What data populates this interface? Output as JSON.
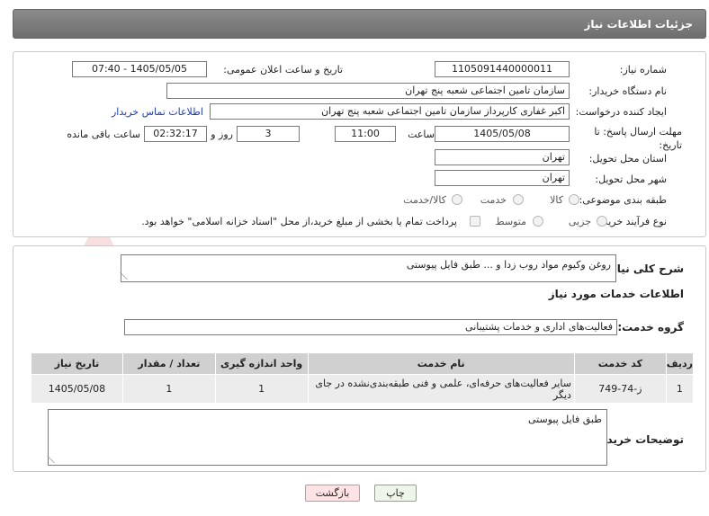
{
  "header": {
    "title": "جزئیات اطلاعات نیاز"
  },
  "form": {
    "need_number_label": "شماره نیاز:",
    "need_number": "1105091440000011",
    "announce_label": "تاریخ و ساعت اعلان عمومی:",
    "announce_value": "1405/05/05 - 07:40",
    "buyer_org_label": "نام دستگاه خریدار:",
    "buyer_org": "سازمان تامین اجتماعی شعبه پنج تهران",
    "creator_label": "ایجاد کننده درخواست:",
    "creator": "اکبر غفاری کارپرداز  سازمان تامین اجتماعی شعبه پنج تهران",
    "contact_link": "اطلاعات تماس خریدار",
    "deadline_label": "مهلت ارسال پاسخ: تا تاریخ:",
    "deadline_date": "1405/05/08",
    "time_label": "ساعت",
    "deadline_time": "11:00",
    "days_value": "3",
    "days_label": "روز و",
    "remaining_time": "02:32:17",
    "remaining_label": "ساعت باقی مانده",
    "province_label": "استان محل تحویل:",
    "province": "تهران",
    "city_label": "شهر محل تحویل:",
    "city": "تهران",
    "category_label": "طبقه بندی موضوعی:",
    "category_options": [
      "کالا",
      "خدمت",
      "کالا/خدمت"
    ],
    "purchase_type_label": "نوع فرآیند خرید :",
    "purchase_options": [
      "جزیی",
      "متوسط"
    ],
    "payment_note": "پرداخت تمام یا بخشی از مبلغ خرید،از محل \"اسناد خزانه اسلامی\" خواهد بود."
  },
  "summary": {
    "label": "شرح کلی نیاز:",
    "value": "روغن وکیوم مواد روب زدا و ... طبق فایل پیوستی"
  },
  "services_title": "اطلاعات خدمات مورد نیاز",
  "service_group": {
    "label": "گروه خدمت:",
    "value": "فعالیت‌های اداری و خدمات پشتیبانی"
  },
  "table": {
    "headers": [
      "ردیف",
      "کد خدمت",
      "نام خدمت",
      "واحد اندازه گیری",
      "تعداد / مقدار",
      "تاریخ نیاز"
    ],
    "rows": [
      [
        "1",
        "ز-74-749",
        "سایر فعالیت‌های حرفه‌ای، علمی و فنی طبقه‌بندی‌نشده در جای دیگر",
        "1",
        "1",
        "1405/05/08"
      ]
    ]
  },
  "buyer_notes": {
    "label": "توضیحات خریدار:",
    "value": "طبق فایل پیوستی"
  },
  "buttons": {
    "print": "چاپ",
    "back": "بازگشت"
  },
  "watermark": "AriaTender.net"
}
